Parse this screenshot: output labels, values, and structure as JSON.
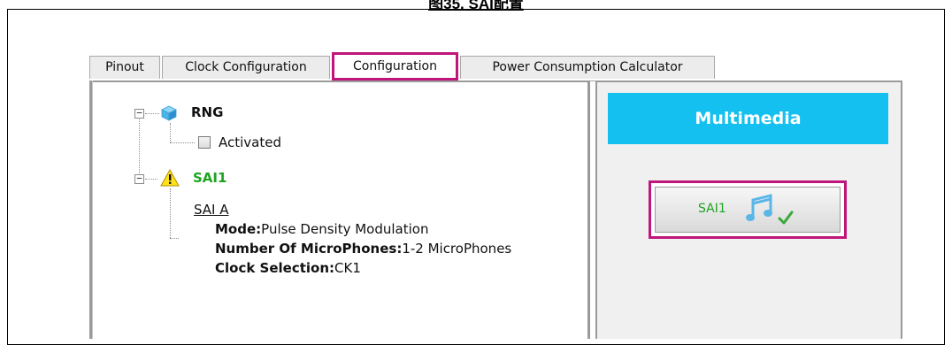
{
  "caption": "图35. SAI配置",
  "tabs": [
    {
      "label": "Pinout"
    },
    {
      "label": "Clock Configuration"
    },
    {
      "label": "Configuration"
    },
    {
      "label": "Power Consumption Calculator"
    }
  ],
  "active_tab": "Configuration",
  "tree": {
    "rng": {
      "label": "RNG",
      "child_label": "Activated",
      "checked": false
    },
    "sai1": {
      "label": "SAI1",
      "status_color": "#1fa31f",
      "sub_block": "SAI A",
      "props": [
        {
          "key": "Mode:",
          "value": "Pulse Density Modulation"
        },
        {
          "key": "Number Of MicroPhones:",
          "value": "1-2 MicroPhones"
        },
        {
          "key": "Clock Selection:",
          "value": "CK1"
        }
      ]
    }
  },
  "right_panel": {
    "header": "Multimedia",
    "header_color": "#14c0ef",
    "button_label": "SAI1"
  },
  "highlight_color": "#c0157a",
  "icons": {
    "rng": "cube-icon",
    "sai1": "warning-icon",
    "sai_button": "music-note-icon",
    "sai_check": "checkmark-icon"
  }
}
